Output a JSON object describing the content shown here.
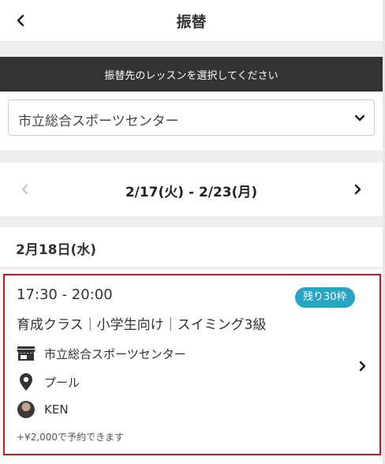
{
  "header": {
    "title": "振替",
    "back_icon": "chevron-left-icon"
  },
  "banner": {
    "text": "振替先のレッスンを選択してください"
  },
  "facility_select": {
    "selected": "市立総合スポーツセンター",
    "icon": "chevron-down-icon"
  },
  "week_nav": {
    "range": "2/17(火) - 2/23(月)",
    "prev_icon": "chevron-left-icon",
    "next_icon": "chevron-right-icon"
  },
  "date_heading": "2月18日(水)",
  "lesson": {
    "time": "17:30 - 20:00",
    "seats_badge": "残り30枠",
    "title": "育成クラス｜小学生向け｜スイミング3級",
    "venue": "市立総合スポーツセンター",
    "place": "プール",
    "coach": "KEN",
    "price_note": "+¥2,000で予約できます",
    "icons": {
      "venue": "store-icon",
      "place": "map-pin-icon",
      "coach": "avatar",
      "detail": "chevron-right-icon"
    }
  },
  "colors": {
    "banner_bg": "#333333",
    "badge_bg": "#27a6c4",
    "highlight_border": "#d0121b",
    "section_gap": "#eeeeee"
  }
}
